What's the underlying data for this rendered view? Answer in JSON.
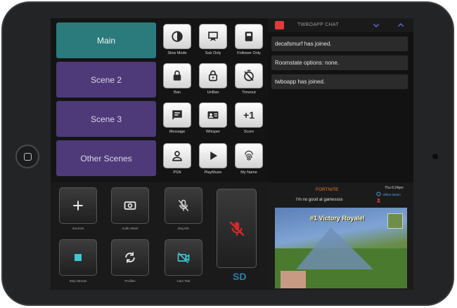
{
  "scenes": [
    "Main",
    "Scene 2",
    "Scene 3",
    "Other Scenes"
  ],
  "grid_buttons": [
    {
      "label": "Slow Mode",
      "icon": "slow-mode-icon"
    },
    {
      "label": "Sub Only",
      "icon": "sub-only-icon"
    },
    {
      "label": "Follower Only",
      "icon": "follower-only-icon"
    },
    {
      "label": "Ban",
      "icon": "lock-icon"
    },
    {
      "label": "UnBan",
      "icon": "unlock-icon"
    },
    {
      "label": "Timeout",
      "icon": "timer-off-icon"
    },
    {
      "label": "Message",
      "icon": "message-icon"
    },
    {
      "label": "Whisper",
      "icon": "contact-card-icon"
    },
    {
      "label": "Score",
      "icon": "plus-one-icon",
      "text": "+1"
    },
    {
      "label": "PSN",
      "icon": "user-icon"
    },
    {
      "label": "PlayMusic",
      "icon": "play-icon"
    },
    {
      "label": "My Name",
      "icon": "fingerprint-icon"
    }
  ],
  "dark_buttons": [
    {
      "label": "Sources",
      "icon": "plus-icon"
    },
    {
      "label": "Audio Mixer",
      "icon": "audio-mixer-icon"
    },
    {
      "label": "Dsg Mic",
      "icon": "mic-off-icon"
    },
    {
      "label": "Stop Stream",
      "icon": "stop-icon"
    },
    {
      "label": "Profiles",
      "icon": "sync-icon"
    },
    {
      "label": "Cam Test",
      "icon": "camera-off-icon"
    }
  ],
  "chat": {
    "title": "TWBOAPP CHAT",
    "messages": [
      "decafsmurf has joined.",
      "Roomstate options: none.",
      "twboapp has joined."
    ]
  },
  "stream": {
    "game": "FORTNITE",
    "time": "Thu 6:24pm",
    "duration": "00hrs 02min",
    "status": "I'm no good at gamessss",
    "banner": "#1 Victory Royale!"
  },
  "colors": {
    "scene_active": "#2b7a7c",
    "scene": "#4e3a78",
    "accent": "#e23b3b"
  }
}
